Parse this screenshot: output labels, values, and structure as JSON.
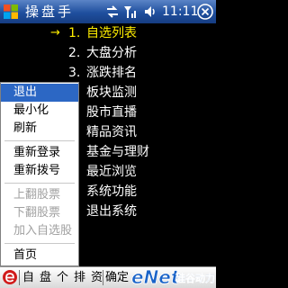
{
  "titlebar": {
    "title": "操盘手",
    "clock": "11:11"
  },
  "main_menu": {
    "selected_marker": "→",
    "items": [
      {
        "num": "1.",
        "label": "自选列表"
      },
      {
        "num": "2.",
        "label": "大盘分析"
      },
      {
        "num": "3.",
        "label": "涨跌排名"
      },
      {
        "num": "",
        "label": "板块监测"
      },
      {
        "num": "",
        "label": "股市直播"
      },
      {
        "num": "",
        "label": "精品资讯"
      },
      {
        "num": "",
        "label": "基金与理财"
      },
      {
        "num": "",
        "label": "最近浏览"
      },
      {
        "num": "",
        "label": "系统功能"
      },
      {
        "num": ".",
        "label": "退出系统"
      }
    ]
  },
  "popup_menu": {
    "items": [
      "退出",
      "最小化",
      "刷新",
      "重新登录",
      "重新拨号",
      "上翻股票",
      "下翻股票",
      "加入自选股",
      "首页"
    ]
  },
  "toolbar": {
    "tabs": [
      "自",
      "盘",
      "个",
      "排",
      "资"
    ],
    "confirm": "确定"
  },
  "watermark": {
    "brand": "eNet",
    "site": "硅谷动力"
  },
  "colors": {
    "titlebar": "#1f4f9e",
    "highlight": "#2c67c4",
    "selected_text": "#ffee00"
  }
}
